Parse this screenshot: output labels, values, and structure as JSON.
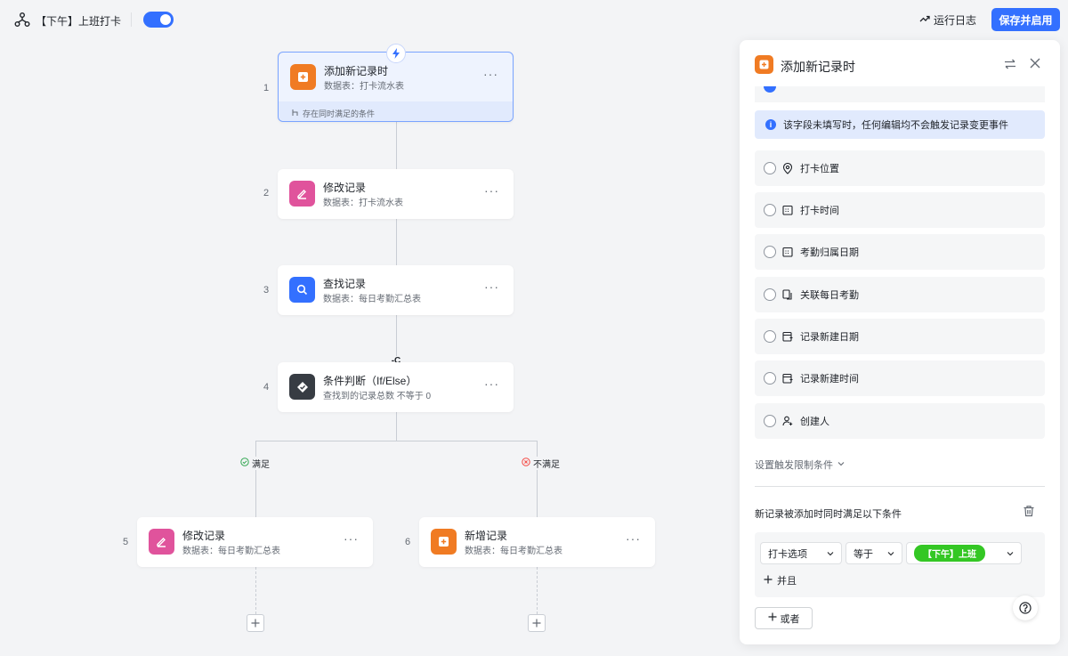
{
  "header": {
    "flow_title": "【下午】上班打卡",
    "enabled": true,
    "run_log_label": "运行日志",
    "save_label": "保存并启用"
  },
  "canvas": {
    "nodes": [
      {
        "index": "1",
        "title": "添加新记录时",
        "subtitle": "数据表：打卡流水表",
        "icon": "add-record-icon",
        "color": "#f07b23",
        "footer": "存在同时满足的条件"
      },
      {
        "index": "2",
        "title": "修改记录",
        "subtitle": "数据表：打卡流水表",
        "icon": "edit-icon",
        "color": "#e0539c"
      },
      {
        "index": "3",
        "title": "查找记录",
        "subtitle": "数据表：每日考勤汇总表",
        "icon": "search-icon",
        "color": "#3370ff"
      },
      {
        "index": "4",
        "title": "条件判断（If/Else）",
        "subtitle": "查找到的记录总数 不等于 0",
        "icon": "condition-icon",
        "color": "#373c43"
      },
      {
        "index": "5",
        "title": "修改记录",
        "subtitle": "数据表：每日考勤汇总表",
        "icon": "edit-icon",
        "color": "#e0539c"
      },
      {
        "index": "6",
        "title": "新增记录",
        "subtitle": "数据表：每日考勤汇总表",
        "icon": "add-record-icon",
        "color": "#f07b23"
      }
    ],
    "more_label": "···",
    "branch_yes": "满足",
    "branch_no": "不满足",
    "connector_mark": "-C"
  },
  "panel": {
    "title": "添加新记录时",
    "info_text": "该字段未填写时，任何编辑均不会触发记录变更事件",
    "fields": [
      {
        "label": "打卡位置",
        "icon": "location-icon"
      },
      {
        "label": "打卡时间",
        "icon": "calendar-icon"
      },
      {
        "label": "考勤归属日期",
        "icon": "calendar-icon"
      },
      {
        "label": "关联每日考勤",
        "icon": "link-record-icon"
      },
      {
        "label": "记录新建日期",
        "icon": "created-date-icon"
      },
      {
        "label": "记录新建时间",
        "icon": "created-date-icon"
      },
      {
        "label": "创建人",
        "icon": "creator-icon"
      }
    ],
    "limit_label": "设置触发限制条件",
    "condition_title": "新记录被添加时同时满足以下条件",
    "condition": {
      "field": "打卡选项",
      "operator": "等于",
      "value": "【下午】上班"
    },
    "and_label": "并且",
    "or_label": "或者",
    "colors": {
      "accent": "#3370ff",
      "value_pill": "#34c724"
    }
  }
}
